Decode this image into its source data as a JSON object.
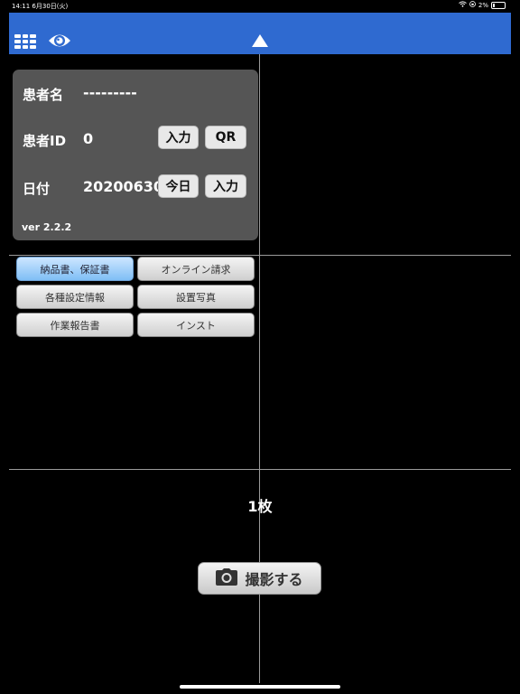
{
  "status_bar": {
    "time": "14:11",
    "date": "6月30日(火)",
    "battery": "2%"
  },
  "patient_panel": {
    "name_label": "患者名",
    "name_value": "---------",
    "id_label": "患者ID",
    "id_value": "0",
    "id_input_button": "入力",
    "id_qr_button": "QR",
    "date_label": "日付",
    "date_value": "20200630",
    "date_today_button": "今日",
    "date_input_button": "入力",
    "version": "ver 2.2.2"
  },
  "category_buttons": [
    {
      "label": "納品書、保証書",
      "active": true
    },
    {
      "label": "オンライン請求",
      "active": false
    },
    {
      "label": "各種設定情報",
      "active": false
    },
    {
      "label": "設置写真",
      "active": false
    },
    {
      "label": "作業報告書",
      "active": false
    },
    {
      "label": "インスト",
      "active": false
    }
  ],
  "photo_count": "1枚",
  "shoot_button": {
    "label": "撮影する",
    "icon": "camera-icon"
  },
  "colors": {
    "toolbar": "#2f6ad0",
    "panel": "#555555",
    "active_button": "#7fbef5",
    "crosshair": "#9a9a9a"
  }
}
